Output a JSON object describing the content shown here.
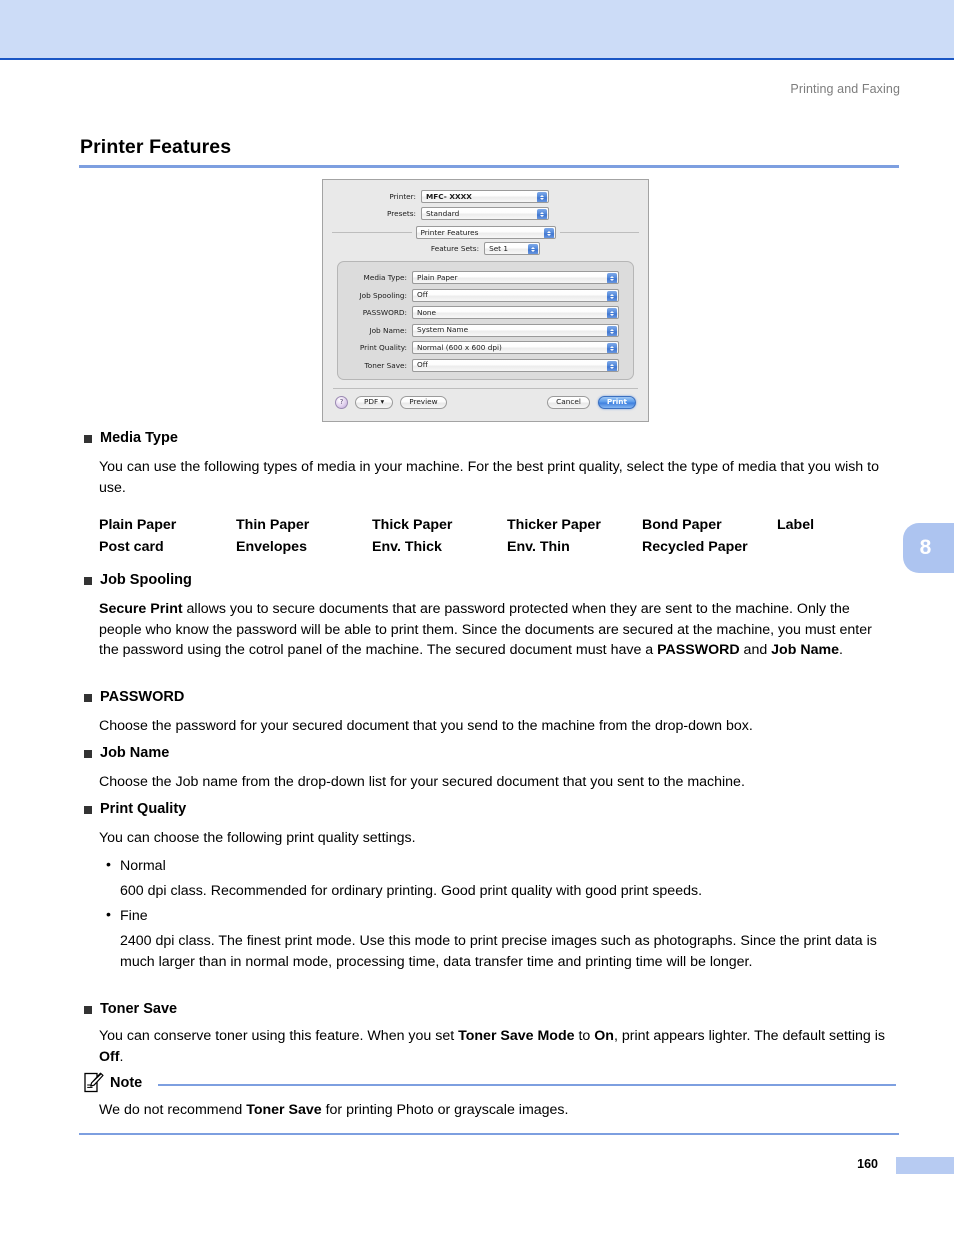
{
  "header": {
    "running_head": "Printing and Faxing",
    "title": "Printer Features",
    "chapter_tab": "8"
  },
  "dialog": {
    "rows_top": [
      {
        "label": "Printer:",
        "value": "MFC- XXXX"
      },
      {
        "label": "Presets:",
        "value": "Standard"
      }
    ],
    "pane_selector": "Printer Features",
    "feature_sets": {
      "label": "Feature Sets:",
      "value": "Set 1"
    },
    "features": [
      {
        "label": "Media Type:",
        "value": "Plain Paper"
      },
      {
        "label": "Job Spooling:",
        "value": "Off"
      },
      {
        "label": "PASSWORD:",
        "value": "None"
      },
      {
        "label": "Job Name:",
        "value": "System Name"
      },
      {
        "label": "Print Quality:",
        "value": "Normal (600 x 600 dpi)"
      },
      {
        "label": "Toner Save:",
        "value": "Off"
      }
    ],
    "buttons": {
      "help": "?",
      "pdf": "PDF ▾",
      "preview": "Preview",
      "cancel": "Cancel",
      "print": "Print"
    }
  },
  "sections": {
    "media_type": {
      "heading": "Media Type",
      "body_line1": "You can use the following types of media in your machine. For the best print quality, select the type of",
      "body_line2": "media that you wish to use.",
      "table": {
        "row1": [
          "Plain Paper",
          "Thin Paper",
          "Thick Paper",
          "Thicker Paper",
          "Bond Paper",
          "Label"
        ],
        "row2": [
          "Post card",
          "Envelopes",
          "Env. Thick",
          "Env. Thin",
          "Recycled Paper",
          ""
        ]
      }
    },
    "job_spooling": {
      "heading": "Job Spooling",
      "bold_lead": "Secure Print",
      "text_a": " allows you to secure documents that are password protected when they are sent to the machine. Only the people who know the password will be able to print them. Since the documents are secured at the machine, you must enter the password using the cotrol panel of the machine. The secured document must have a ",
      "bold_password": "PASSWORD",
      "text_b": " and ",
      "bold_jobname": "Job Name",
      "text_c": "."
    },
    "password": {
      "heading": "PASSWORD",
      "body": "Choose the password for your secured document that you send to the machine from the drop-down box."
    },
    "job_name": {
      "heading": "Job Name",
      "body": "Choose the Job name from the drop-down list for your secured document that you sent to the machine."
    },
    "print_quality": {
      "heading": "Print Quality",
      "body": "You can choose the following print quality settings.",
      "items": [
        {
          "bullet": "•",
          "name": "Normal",
          "desc": "600 dpi class. Recommended for ordinary printing. Good print quality with good print speeds."
        },
        {
          "bullet": "•",
          "name": "Fine",
          "desc": "2400 dpi class. The finest print mode. Use this mode to print precise images such as photographs. Since the print data is much larger than in normal mode, processing time, data transfer time and printing time will be longer."
        }
      ]
    },
    "toner_save": {
      "heading": "Toner Save",
      "text_a": "You can conserve toner using this feature. When you set ",
      "bold_mode": "Toner Save Mode",
      "text_b": " to ",
      "bold_on": "On",
      "text_c": ", print appears lighter. The default setting is ",
      "bold_off": "Off",
      "text_d": "."
    }
  },
  "note": {
    "label": "Note",
    "text_a": "We do not recommend ",
    "bold_toner": "Toner Save",
    "text_b": " for printing Photo or grayscale images."
  },
  "footer": {
    "page_number": "160"
  },
  "colors": {
    "banner": "#ccdcf7",
    "banner_border": "#1a56c4",
    "rule_blue": "#7d9fe0",
    "tab_blue": "#adc4f0",
    "folio_bar": "#b7cbf2",
    "print_button": "#3f80df"
  }
}
